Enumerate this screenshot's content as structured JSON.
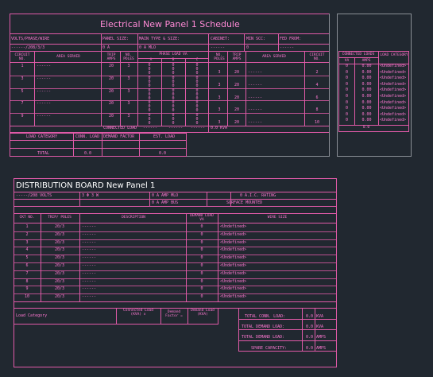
{
  "panel1": {
    "title": "Electrical New  Panel 1  Schedule",
    "volts_label": "VOLTS/PHASE/WIRE",
    "volts_value": "------/208/3/3",
    "panel_size_label": "PANEL SIZE:",
    "panel_size_value": "0 A",
    "main_type_label": "MAIN TYPE & SIZE:",
    "main_type_value": "0 A MLO",
    "cabinet_label": "CABINET:",
    "cabinet_value": "------",
    "min_scc_label": "MIN SCC:",
    "min_scc_value": "0",
    "fed_from_label": "FED FROM:",
    "fed_from_value": "------",
    "headers": {
      "circuit_no": "CIRCUIT NO.",
      "area_served": "AREA SERVED",
      "trip_amps": "TRIP AMPS",
      "no_poles": "NO. POLES",
      "phase_load": "PHASE LOAD VA",
      "phase_a": "A",
      "phase_b": "B",
      "phase_c": "C",
      "no_poles_r": "NO. POLES",
      "trip_amps_r": "TRIP AMPS",
      "area_served_r": "AREA SERVED",
      "circuit_no_r": "CIRCUIT NO."
    },
    "left_circuits": [
      {
        "no": "1",
        "area": "------",
        "trip": "20",
        "poles": "3"
      },
      {
        "no": "3",
        "area": "------",
        "trip": "20",
        "poles": "3"
      },
      {
        "no": "5",
        "area": "------",
        "trip": "20",
        "poles": "3"
      },
      {
        "no": "7",
        "area": "------",
        "trip": "20",
        "poles": "3"
      },
      {
        "no": "9",
        "area": "------",
        "trip": "20",
        "poles": "3"
      }
    ],
    "right_circuits": [
      {
        "no": "2",
        "area": "------",
        "trip": "20",
        "poles": "3"
      },
      {
        "no": "4",
        "area": "------",
        "trip": "20",
        "poles": "3"
      },
      {
        "no": "6",
        "area": "------",
        "trip": "20",
        "poles": "3"
      },
      {
        "no": "8",
        "area": "------",
        "trip": "20",
        "poles": "3"
      },
      {
        "no": "10",
        "area": "------",
        "trip": "20",
        "poles": "3"
      }
    ],
    "connected_load_label": "CONNECTED LOAD",
    "connected_a": "------",
    "connected_b": "------",
    "connected_c": "------",
    "connected_total": "0.0 KVA",
    "load_category_label": "LOAD CATEGORY",
    "conn_load_label": "CONN. LOAD",
    "demand_factor_label": "DEMAND FACTOR",
    "est_load_label": "EST. LOAD",
    "total_label": "TOTAL",
    "total_conn": "0.0",
    "total_est": "0.0",
    "side": {
      "title": "CONNECTED LOADS",
      "va_label": "VA",
      "amps_label": "AMPS",
      "category_label": "LOAD CATEGORY",
      "rows": [
        {
          "va": "0",
          "amps": "0.00",
          "cat": "<Undefined>"
        },
        {
          "va": "0",
          "amps": "0.00",
          "cat": "<Undefined>"
        },
        {
          "va": "0",
          "amps": "0.00",
          "cat": "<Undefined>"
        },
        {
          "va": "0",
          "amps": "0.00",
          "cat": "<Undefined>"
        },
        {
          "va": "0",
          "amps": "0.00",
          "cat": "<Undefined>"
        },
        {
          "va": "0",
          "amps": "0.00",
          "cat": "<Undefined>"
        },
        {
          "va": "0",
          "amps": "0.00",
          "cat": "<Undefined>"
        },
        {
          "va": "0",
          "amps": "0.00",
          "cat": "<Undefined>"
        },
        {
          "va": "0",
          "amps": "0.00",
          "cat": "<Undefined>"
        },
        {
          "va": "0",
          "amps": "0.00",
          "cat": "<Undefined>"
        }
      ],
      "total": "0.0"
    }
  },
  "panel2": {
    "title": "DISTRIBUTION  BOARD  New  Panel 1",
    "volts": "-----/208 VOLTS",
    "phase": "3 Φ 3 W",
    "amp_mlo": "0 A  AMP MLO",
    "amp_bus": "0 A  AMP BUS",
    "aic_rating": "0  A.I.C. RATING",
    "surface": "SURFACE  MOUNTED",
    "headers": {
      "ckt_no": "CKT NO.",
      "trip_poles": "TRIP/ POLES",
      "description": "DESCRIPTION",
      "demand_load": "DEMAND LOAD",
      "demand_unit": "VA",
      "wire_size": "WIRE SIZE"
    },
    "rows": [
      {
        "no": "1",
        "trip": "20/3",
        "desc": "------",
        "load": "0",
        "wire": "<Undefined>"
      },
      {
        "no": "2",
        "trip": "20/3",
        "desc": "------",
        "load": "0",
        "wire": "<Undefined>"
      },
      {
        "no": "3",
        "trip": "20/3",
        "desc": "------",
        "load": "0",
        "wire": "<Undefined>"
      },
      {
        "no": "4",
        "trip": "20/3",
        "desc": "------",
        "load": "0",
        "wire": "<Undefined>"
      },
      {
        "no": "5",
        "trip": "20/3",
        "desc": "------",
        "load": "0",
        "wire": "<Undefined>"
      },
      {
        "no": "6",
        "trip": "20/3",
        "desc": "------",
        "load": "0",
        "wire": "<Undefined>"
      },
      {
        "no": "7",
        "trip": "20/3",
        "desc": "------",
        "load": "0",
        "wire": "<Undefined>"
      },
      {
        "no": "8",
        "trip": "20/3",
        "desc": "------",
        "load": "0",
        "wire": "<Undefined>"
      },
      {
        "no": "9",
        "trip": "20/3",
        "desc": "------",
        "load": "0",
        "wire": "<Undefined>"
      },
      {
        "no": "10",
        "trip": "20/3",
        "desc": "------",
        "load": "0",
        "wire": "<Undefined>"
      }
    ],
    "load_category": "Load Category",
    "connected_load": "Connected Load (KVA) x",
    "demand_factor": "Demand Factor =",
    "demand_load": "Demand Load (KVA)",
    "total_conn_label": "TOTAL CONN. LOAD:",
    "total_conn_value": "0.0",
    "total_conn_unit": "KVA",
    "total_demand_label": "TOTAL DEMAND LOAD:",
    "total_demand_value": "0.0",
    "total_demand_unit": "KVA",
    "total_demand_amps_label": "TOTAL DEMAND LOAD:",
    "total_demand_amps_value": "0.0",
    "total_demand_amps_unit": "AMPS",
    "spare_label": "SPARE CAPACITY:",
    "spare_value": "0.0",
    "spare_unit": "AMPS"
  },
  "colors": {
    "background": "#212830",
    "line": "#e05aa8",
    "text": "#ff78d2",
    "gray": "#8a8f96"
  }
}
